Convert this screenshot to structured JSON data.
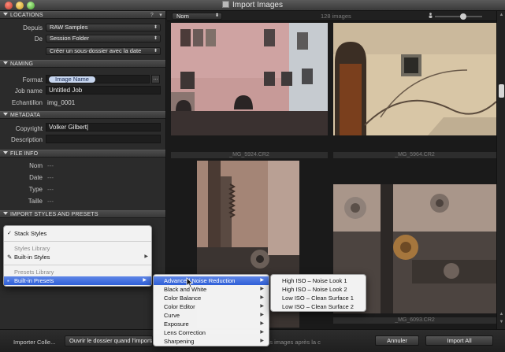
{
  "window": {
    "title": "Import Images"
  },
  "sections": {
    "locations": {
      "title": "LOCATIONS",
      "help": "?"
    },
    "naming": {
      "title": "NAMING"
    },
    "metadata": {
      "title": "METADATA"
    },
    "file_info": {
      "title": "FILE INFO"
    },
    "import_styles": {
      "title": "IMPORT STYLES AND PRESETS"
    }
  },
  "locations": {
    "depuis_label": "Depuis",
    "depuis_value": "RAW Samples",
    "de_label": "De",
    "de_value": "Session Folder",
    "subfolder_value": "Créer un sous-dossier avec la date"
  },
  "naming": {
    "format_label": "Format",
    "format_token": "Image Name",
    "more_button": "...",
    "jobname_label": "Job name",
    "jobname_value": "Untitled Job",
    "echantillon_label": "Echantillon",
    "echantillon_value": "img_0001"
  },
  "metadata": {
    "copyright_label": "Copyright",
    "copyright_value": "Volker Gilbert",
    "description_label": "Description",
    "description_value": ""
  },
  "file_info": {
    "nom_label": "Nom",
    "nom_value": "---",
    "date_label": "Date",
    "date_value": "---",
    "type_label": "Type",
    "type_value": "---",
    "taille_label": "Taille",
    "taille_value": "---"
  },
  "browser": {
    "sort_value": "Nom",
    "count_text": "128 images",
    "captions": [
      "_MG_5924.CR2",
      "_MG_5964.CR2",
      "",
      "_MG_6093.CR2"
    ]
  },
  "menu_main": {
    "stack_styles": "Stack Styles",
    "styles_library_header": "Styles Library",
    "builtin_styles": "Built-in Styles",
    "presets_library_header": "Presets Library",
    "builtin_presets": "Built-in Presets"
  },
  "menu_presets": {
    "items": [
      "Advanced Noise Reduction",
      "Black and White",
      "Color Balance",
      "Color Editor",
      "Curve",
      "Exposure",
      "Lens Correction",
      "Sharpening"
    ]
  },
  "menu_noise": {
    "items": [
      "High ISO – Noise Look 1",
      "High ISO – Noise Look 2",
      "Low ISO – Clean Surface 1",
      "Low ISO – Clean Surface 2"
    ]
  },
  "bottom": {
    "import_label": "Importer Colle...",
    "open_folder_popup": "Ouvrir le dossier quand l'importation est terminée",
    "check_label": "...s images après la c",
    "cancel_button": "Annuler",
    "import_all_button": "Import All"
  },
  "colors": {
    "menu_highlight": "#3a6ae0",
    "token_bg": "#c7d6ef",
    "panel_bg": "#2b2b2b"
  },
  "icons": [
    "close-icon",
    "minimize-icon",
    "zoom-icon",
    "disclosure-triangle-icon",
    "brush-icon",
    "person-icon",
    "submenu-arrow-icon",
    "pointer-cursor-icon"
  ]
}
